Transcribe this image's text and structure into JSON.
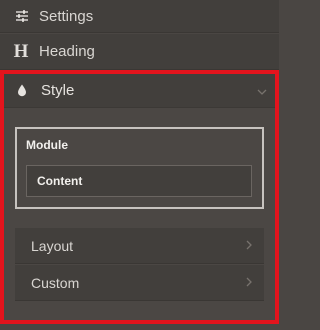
{
  "sections": {
    "settings": {
      "label": "Settings",
      "icon": "sliders-icon"
    },
    "heading": {
      "label": "Heading",
      "icon_glyph": "H"
    },
    "style": {
      "label": "Style",
      "icon": "droplet-icon",
      "expanded": true
    }
  },
  "style_panel": {
    "module": {
      "label": "Module",
      "content_label": "Content"
    },
    "sub_items": [
      {
        "label": "Layout"
      },
      {
        "label": "Custom"
      }
    ]
  },
  "colors": {
    "highlight_border": "#e3141d",
    "panel_bg": "#4a4643"
  }
}
